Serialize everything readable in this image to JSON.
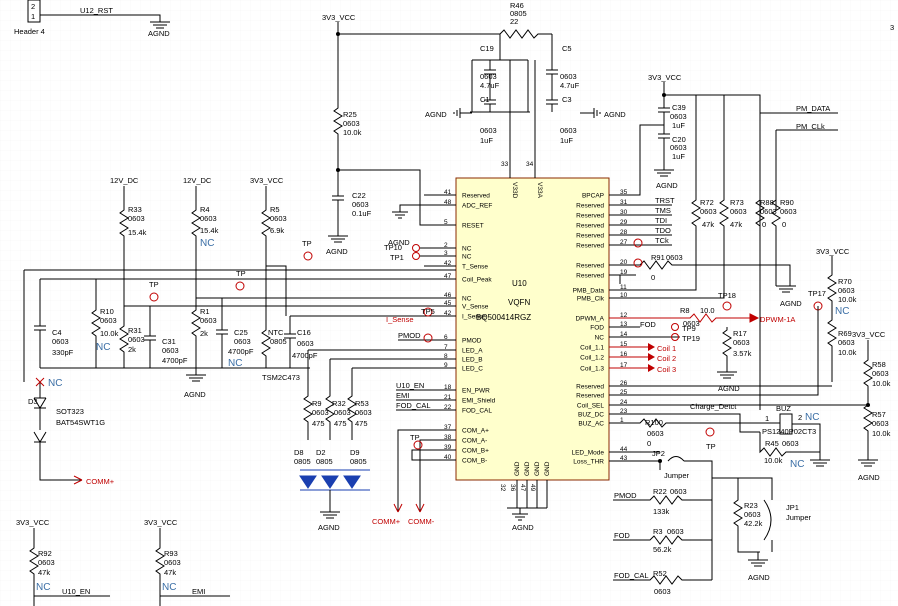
{
  "header4": {
    "title": "Header 4",
    "pin1": "1",
    "pin2": "2",
    "net": "U12_RST",
    "gnd": "AGND"
  },
  "page_marker": "3",
  "ic": {
    "ref": "U10",
    "package": "VQFN",
    "part": "BQ500414RGZ",
    "left_pins": [
      {
        "num": "41",
        "name": "Reserved"
      },
      {
        "num": "48",
        "name": "ADC_REF"
      },
      {
        "num": "5",
        "name": "RESET"
      },
      {
        "num": "2",
        "name": "NC"
      },
      {
        "num": "3",
        "name": "NC"
      },
      {
        "num": "42",
        "name": "T_Sense"
      },
      {
        "num": "47",
        "name": "Coil_Peak"
      },
      {
        "num": "46",
        "name": "NC"
      },
      {
        "num": "45",
        "name": "V_Sense"
      },
      {
        "num": "42",
        "name": "I_Sense"
      },
      {
        "num": "6",
        "name": "PMOD"
      },
      {
        "num": "7",
        "name": "LED_A"
      },
      {
        "num": "8",
        "name": "LED_B"
      },
      {
        "num": "9",
        "name": "LED_C"
      },
      {
        "num": "18",
        "name": "EN_PWR"
      },
      {
        "num": "21",
        "name": "EMI_Shield"
      },
      {
        "num": "22",
        "name": "FOD_CAL"
      },
      {
        "num": "37",
        "name": "COM_A+"
      },
      {
        "num": "38",
        "name": "COM_A-"
      },
      {
        "num": "39",
        "name": "COM_B+"
      },
      {
        "num": "40",
        "name": "COM_B-"
      }
    ],
    "right_pins": [
      {
        "num": "35",
        "name": "BPCAP"
      },
      {
        "num": "31",
        "name": "Reserved"
      },
      {
        "num": "30",
        "name": "Reserved"
      },
      {
        "num": "29",
        "name": "Reserved"
      },
      {
        "num": "28",
        "name": "Reserved"
      },
      {
        "num": "27",
        "name": "Reserved"
      },
      {
        "num": "20",
        "name": "Reserved"
      },
      {
        "num": "19",
        "name": "Reserved"
      },
      {
        "num": "11",
        "name": "PMB_Data"
      },
      {
        "num": "10",
        "name": "PMB_Clk"
      },
      {
        "num": "12",
        "name": "DPWM_A"
      },
      {
        "num": "13",
        "name": "FOD"
      },
      {
        "num": "14",
        "name": "NC"
      },
      {
        "num": "15",
        "name": "Coil_1.1"
      },
      {
        "num": "16",
        "name": "Coil_1.2"
      },
      {
        "num": "17",
        "name": "Coil_1.3"
      },
      {
        "num": "26",
        "name": "Reserved"
      },
      {
        "num": "25",
        "name": "Reserved"
      },
      {
        "num": "24",
        "name": "Coil_SEL"
      },
      {
        "num": "23",
        "name": "BUZ_DC"
      },
      {
        "num": "1",
        "name": "BUZ_AC"
      },
      {
        "num": "44",
        "name": "LED_Mode"
      },
      {
        "num": "43",
        "name": "Loss_THR"
      }
    ],
    "top_pins": [
      {
        "num": "33",
        "name": "V33D"
      },
      {
        "num": "34",
        "name": "V33A"
      }
    ],
    "bottom_pins": [
      {
        "num": "32",
        "name": "GND"
      },
      {
        "num": "36",
        "name": "GND"
      },
      {
        "num": "47",
        "name": "GND"
      },
      {
        "num": "49",
        "name": "GND"
      }
    ]
  },
  "nets": {
    "v33": "3V3_VCC",
    "v12": "12V_DC",
    "agnd": "AGND",
    "pm_data": "PM_DATA",
    "pm_clk": "PM_CLk",
    "trst": "TRST",
    "tms": "TMS",
    "tdi": "TDI",
    "tdo": "TDO",
    "tck": "TCk",
    "dpwm": "DPWM-1A",
    "fod": "FOD",
    "coil1": "Coil 1",
    "coil2": "Coil 2",
    "coil3": "Coil 3",
    "charge_detect": "Charge_Detct",
    "comm_plus": "COMM+",
    "comm_minus": "COMM-",
    "u10_en": "U10_EN",
    "emi": "EMI",
    "fod_cal": "FOD_CAL",
    "pmod": "PMOD",
    "i_sense": "I_Sense"
  },
  "test_points": {
    "tp": "TP",
    "tp10": "TP10",
    "tp1": "TP1",
    "tp5": "TP5",
    "tp9": "TP9",
    "tp19": "TP19",
    "tp17": "TP17",
    "tp18": "TP18"
  },
  "nc_mark": "NC",
  "components": {
    "r46": {
      "ref": "R46",
      "pkg": "0805",
      "val": "22"
    },
    "c19": {
      "ref": "C19",
      "pkg": "0603",
      "val": "4.7uF"
    },
    "c5": {
      "ref": "C5",
      "pkg": "0603",
      "val": "4.7uF"
    },
    "c1": {
      "ref": "C1",
      "pkg": "0603",
      "val": "1uF"
    },
    "c3": {
      "ref": "C3",
      "pkg": "0603",
      "val": "1uF"
    },
    "r25": {
      "ref": "R25",
      "pkg": "0603",
      "val": "10.0k"
    },
    "c22": {
      "ref": "C22",
      "pkg": "0603",
      "val": "0.1uF"
    },
    "c39": {
      "ref": "C39",
      "pkg": "0603",
      "val": "1uF"
    },
    "c20": {
      "ref": "C20",
      "pkg": "0603",
      "val": "1uF"
    },
    "r33": {
      "ref": "R33",
      "pkg": "0603",
      "val": "15.4k"
    },
    "r4": {
      "ref": "R4",
      "pkg": "0603",
      "val": "15.4k"
    },
    "r5": {
      "ref": "R5",
      "pkg": "0603",
      "val": "6.9k"
    },
    "r10": {
      "ref": "R10",
      "pkg": "0603",
      "val": "10.0k"
    },
    "r31": {
      "ref": "R31",
      "pkg": "0603",
      "val": "2k"
    },
    "c31": {
      "ref": "C31",
      "pkg": "0603",
      "val": "4700pF"
    },
    "r1": {
      "ref": "R1",
      "pkg": "0603",
      "val": "2k"
    },
    "c25": {
      "ref": "C25",
      "pkg": "0603",
      "val": "4700pF"
    },
    "ntc": {
      "ref": "NTC",
      "pkg": "0805",
      "val": "TSM2C473"
    },
    "c16": {
      "ref": "C16",
      "pkg": "0603",
      "val": "4700pF"
    },
    "c4": {
      "ref": "C4",
      "pkg": "0603",
      "val": "330pF"
    },
    "d3": {
      "ref": "D3",
      "pkg": "SOT323",
      "val": "BAT54SWT1G"
    },
    "r9": {
      "ref": "R9",
      "pkg": "0603",
      "val": "475"
    },
    "r32": {
      "ref": "R32",
      "pkg": "0603",
      "val": "475"
    },
    "r53": {
      "ref": "R53",
      "pkg": "0603",
      "val": "475"
    },
    "d8": {
      "ref": "D8",
      "pkg": "0805"
    },
    "d2": {
      "ref": "D2",
      "pkg": "0805"
    },
    "d9": {
      "ref": "D9",
      "pkg": "0805"
    },
    "r72": {
      "ref": "R72",
      "pkg": "0603",
      "val": "47k"
    },
    "r73": {
      "ref": "R73",
      "pkg": "0603",
      "val": "47k"
    },
    "r88": {
      "ref": "R88",
      "pkg": "0603",
      "val": "0"
    },
    "r90": {
      "ref": "R90",
      "pkg": "0603",
      "val": "0"
    },
    "r91": {
      "ref": "R91",
      "pkg": "0603",
      "val": "0"
    },
    "r8": {
      "ref": "R8",
      "pkg": "0603",
      "val": "10.0"
    },
    "r17": {
      "ref": "R17",
      "pkg": "0603",
      "val": "3.57k"
    },
    "r70": {
      "ref": "R70",
      "pkg": "0603",
      "val": "10.0k"
    },
    "r69": {
      "ref": "R69",
      "pkg": "0603",
      "val": "10.0k"
    },
    "r58": {
      "ref": "R58",
      "pkg": "0603",
      "val": "10.0k"
    },
    "r57": {
      "ref": "R57",
      "pkg": "0603",
      "val": "10.0k"
    },
    "r100": {
      "ref": "R100",
      "pkg": "0603",
      "val": "0"
    },
    "buz": {
      "ref": "BUZ",
      "val": "PS1240P02CT3",
      "pin1": "1",
      "pin2": "2"
    },
    "r45": {
      "ref": "R45",
      "pkg": "0603",
      "val": "10.0k"
    },
    "jp2": {
      "ref": "JP2",
      "val": "Jumper"
    },
    "jp1": {
      "ref": "JP1",
      "val": "Jumper"
    },
    "r22": {
      "ref": "R22",
      "pkg": "0603",
      "val": "133k"
    },
    "r3": {
      "ref": "R3",
      "pkg": "0603",
      "val": "56.2k"
    },
    "r52": {
      "ref": "R52",
      "pkg": "0603"
    },
    "r23": {
      "ref": "R23",
      "pkg": "0603",
      "val": "42.2k"
    },
    "r92": {
      "ref": "R92",
      "pkg": "0603",
      "val": "47k"
    },
    "r93": {
      "ref": "R93",
      "pkg": "0603",
      "val": "47k"
    }
  }
}
